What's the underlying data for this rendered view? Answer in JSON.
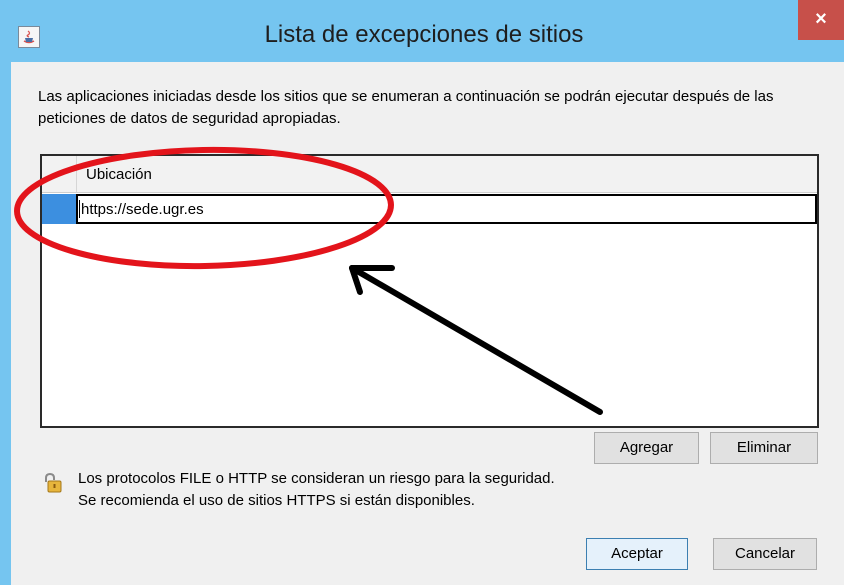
{
  "window": {
    "title": "Lista de excepciones de sitios",
    "close_glyph": "×",
    "app_icon": "java-icon"
  },
  "dialog": {
    "description": "Las aplicaciones iniciadas desde los sitios que se enumeran a continuación se podrán ejecutar después de las peticiones de datos de seguridad apropiadas.",
    "table": {
      "columns": [
        "Ubicación"
      ],
      "rows": [
        {
          "location": "https://sede.ugr.es",
          "selected": true,
          "editing": true
        }
      ]
    },
    "buttons": {
      "add": "Agregar",
      "remove": "Eliminar",
      "ok": "Aceptar",
      "cancel": "Cancelar"
    },
    "warning": {
      "icon": "lock-icon",
      "line1": "Los protocolos FILE o HTTP se consideran un riesgo para la seguridad.",
      "line2": "Se recomienda el uso de sitios HTTPS si están disponibles."
    }
  },
  "annotations": {
    "ellipse_color": "#e3141b",
    "arrow_color": "#000000"
  },
  "colors": {
    "titlebar": "#75c5f0",
    "close_button": "#c7504a",
    "selection": "#3c8fe0"
  }
}
